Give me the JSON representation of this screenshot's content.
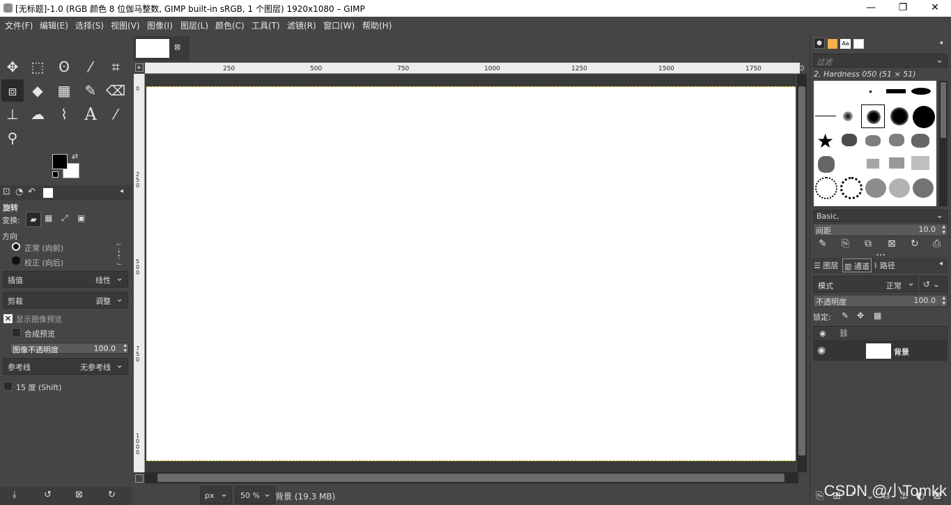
{
  "titlebar": {
    "title": "[无标题]-1.0 (RGB 颜色 8 位伽马整数, GIMP built-in sRGB, 1 个图层) 1920x1080 – GIMP",
    "min": "—",
    "max": "❐",
    "close": "✕"
  },
  "menu": [
    "文件(F)",
    "编辑(E)",
    "选择(S)",
    "视图(V)",
    "图像(I)",
    "图层(L)",
    "颜色(C)",
    "工具(T)",
    "滤镜(R)",
    "窗口(W)",
    "帮助(H)"
  ],
  "toolbox": {
    "tools": [
      {
        "name": "move-tool-icon",
        "glyph": "✥"
      },
      {
        "name": "rect-select-icon",
        "glyph": "⬚"
      },
      {
        "name": "lasso-icon",
        "glyph": "ʘ"
      },
      {
        "name": "fuzzy-select-icon",
        "glyph": "⁄"
      },
      {
        "name": "crop-icon",
        "glyph": "⌗"
      },
      {
        "name": "transform-icon",
        "glyph": "⧈"
      },
      {
        "name": "warp-icon",
        "glyph": "◆"
      },
      {
        "name": "gradient-icon",
        "glyph": "▦"
      },
      {
        "name": "paintbrush-icon",
        "glyph": "✎"
      },
      {
        "name": "eraser-icon",
        "glyph": "⌫"
      },
      {
        "name": "clone-icon",
        "glyph": "⊥"
      },
      {
        "name": "smudge-icon",
        "glyph": "☁"
      },
      {
        "name": "paths-icon",
        "glyph": "⌇"
      },
      {
        "name": "text-icon",
        "glyph": "A"
      },
      {
        "name": "color-picker-icon",
        "glyph": "⁄"
      },
      {
        "name": "zoom-icon",
        "glyph": "⚲"
      }
    ],
    "options": {
      "title": "旋转",
      "transform_label": "变换:",
      "direction_label": "方向",
      "direction_normal": "正常 (向前)",
      "direction_corrective": "校正 (向后)",
      "interpolation_label": "插值",
      "interpolation_value": "线性",
      "clipping_label": "剪裁",
      "clipping_value": "调整",
      "show_preview": "显示图像预览",
      "composite_preview": "合成预览",
      "image_opacity_label": "图像不透明度",
      "image_opacity_value": "100.0",
      "guides_label": "参考线",
      "guides_value": "无参考线",
      "snap_15": "15 度 (Shift)"
    }
  },
  "canvas": {
    "ruler_h": [
      "250",
      "500",
      "750",
      "1000",
      "1250",
      "1500",
      "1750"
    ],
    "ruler_v": [
      "0",
      "250",
      "500",
      "750",
      "1000"
    ],
    "unit": "px",
    "zoom": "50 %",
    "status": "背景 (19.3 MB)"
  },
  "dock": {
    "filter_placeholder": "过滤",
    "brush_name": "2. Hardness 050 (51 × 51)",
    "brush_preset": "Basic,",
    "spacing_label": "间距",
    "spacing_value": "10.0",
    "tabs": [
      "图层",
      "通道",
      "路径"
    ],
    "mode_label": "模式",
    "mode_value": "正常",
    "opacity_label": "不透明度",
    "opacity_value": "100.0",
    "lock_label": "锁定:",
    "layer_name": "背景"
  },
  "watermark": "CSDN @小Tomkk",
  "colors": {
    "ui_bg": "#454545",
    "dark": "#2b2b2b",
    "selection": "#c9b300",
    "canvas": "#ffffff"
  }
}
